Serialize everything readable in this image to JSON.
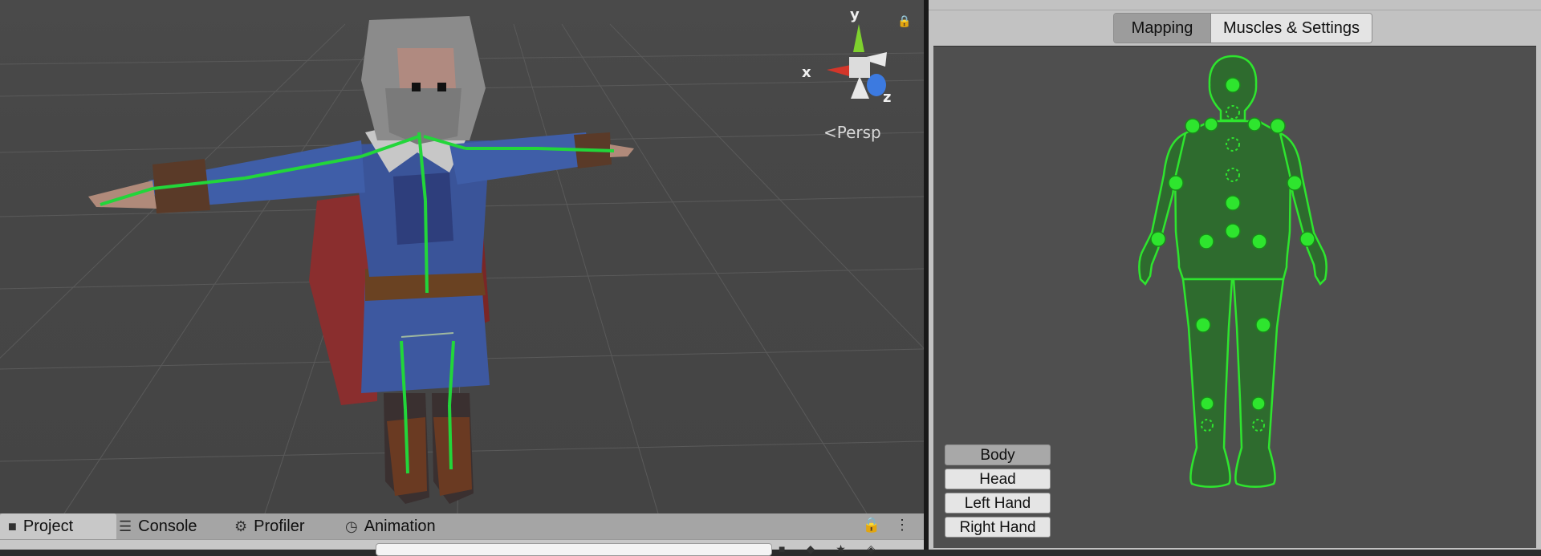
{
  "scene": {
    "view_mode": "Persp",
    "gizmo": {
      "x_label": "x",
      "y_label": "y",
      "z_label": "z"
    }
  },
  "bottom_panel": {
    "tabs": [
      {
        "label": "Project",
        "icon": "folder-icon",
        "active": true
      },
      {
        "label": "Console",
        "icon": "console-icon",
        "active": false
      },
      {
        "label": "Profiler",
        "icon": "profiler-icon",
        "active": false
      },
      {
        "label": "Animation",
        "icon": "animation-icon",
        "active": false
      }
    ]
  },
  "inspector": {
    "tabs": [
      {
        "label": "Mapping",
        "active": true
      },
      {
        "label": "Muscles & Settings",
        "active": false
      }
    ],
    "body_parts": [
      {
        "label": "Body",
        "active": true
      },
      {
        "label": "Head",
        "active": false
      },
      {
        "label": "Left Hand",
        "active": false
      },
      {
        "label": "Right Hand",
        "active": false
      }
    ]
  },
  "colors": {
    "bone_green": "#22d63a",
    "avatar_fill": "#2e6b2e",
    "avatar_outline": "#2ee52e",
    "scene_bg": "#474747",
    "inspector_bg": "#c2c2c2"
  }
}
